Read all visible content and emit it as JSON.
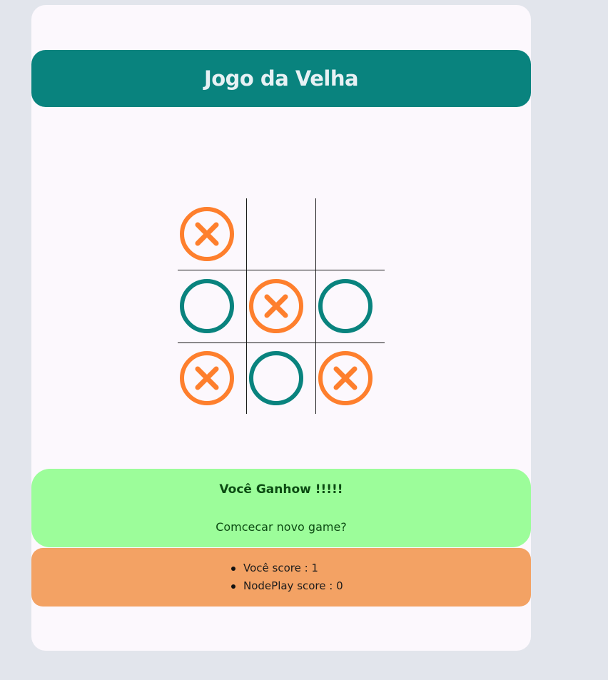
{
  "header": {
    "title": "Jogo da Velha"
  },
  "board": {
    "cells": [
      "X",
      "",
      "",
      "O",
      "X",
      "O",
      "X",
      "O",
      "X"
    ]
  },
  "colors": {
    "x_mark": "#fe7f2d",
    "o_mark": "#09837e",
    "header_bg": "#09837e",
    "result_bg": "#9cfd9a",
    "score_bg": "#f3a264"
  },
  "result": {
    "message": "Você Ganhow !!!!!",
    "restart_label": "Comcecar novo game?"
  },
  "score": {
    "player_label": "Você score : 1",
    "nodeplay_label": "NodePlay score : 0"
  }
}
